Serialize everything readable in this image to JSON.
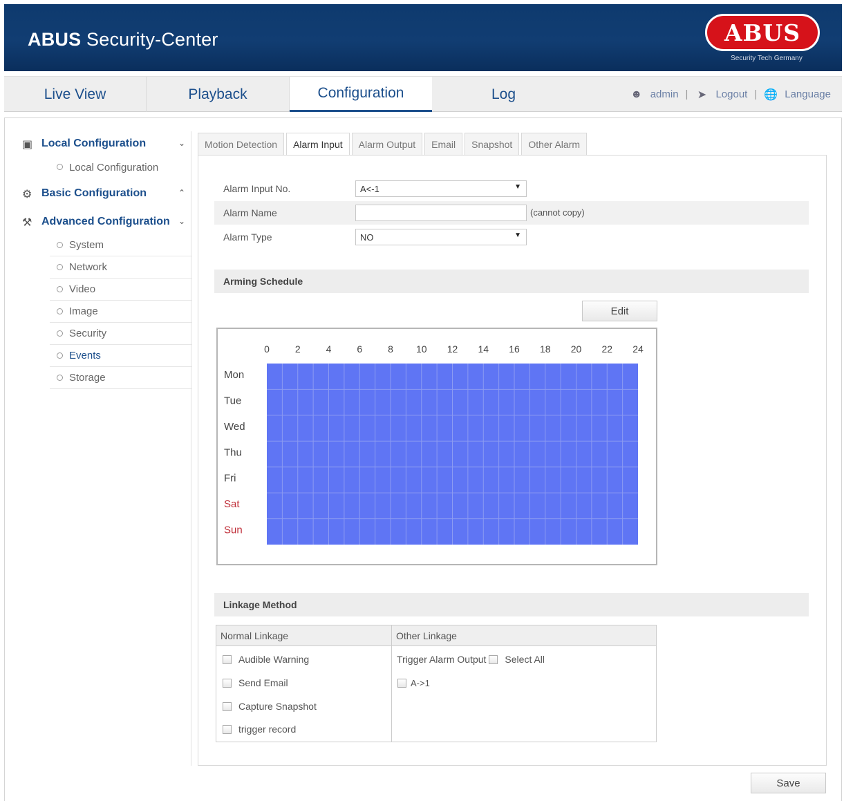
{
  "header": {
    "title_brand": "ABUS",
    "title_rest": " Security-Center",
    "logo_text": "ABUS",
    "logo_tagline": "Security Tech Germany",
    "colors": {
      "header_bg": "#113d72",
      "logo_red": "#d6121a",
      "link_blue": "#1c4f8c",
      "schedule_fill": "#5f75f4",
      "weekend_red": "#c0303a"
    }
  },
  "nav": {
    "tabs": [
      "Live View",
      "Playback",
      "Configuration",
      "Log"
    ],
    "active_tab": "Configuration",
    "user": "admin",
    "logout": "Logout",
    "language": "Language",
    "sep": "|"
  },
  "sidebar": {
    "local_group": "Local Configuration",
    "local_items": [
      "Local Configuration"
    ],
    "basic_group": "Basic Configuration",
    "advanced_group": "Advanced Configuration",
    "advanced_items": [
      "System",
      "Network",
      "Video",
      "Image",
      "Security",
      "Events",
      "Storage"
    ]
  },
  "subtabs": [
    "Motion Detection",
    "Alarm Input",
    "Alarm Output",
    "Email",
    "Snapshot",
    "Other Alarm"
  ],
  "active_subtab": "Alarm Input",
  "form": {
    "alarm_input_no_label": "Alarm Input No.",
    "alarm_input_no_value": "A<-1",
    "alarm_name_label": "Alarm Name",
    "alarm_name_value": "",
    "alarm_name_hint": "(cannot copy)",
    "alarm_type_label": "Alarm Type",
    "alarm_type_value": "NO"
  },
  "arming": {
    "title": "Arming Schedule",
    "edit_button": "Edit",
    "hours": [
      "0",
      "2",
      "4",
      "6",
      "8",
      "10",
      "12",
      "14",
      "16",
      "18",
      "20",
      "22",
      "24"
    ],
    "days": [
      "Mon",
      "Tue",
      "Wed",
      "Thu",
      "Fri",
      "Sat",
      "Sun"
    ],
    "weekend_days": [
      "Sat",
      "Sun"
    ],
    "armed_start_hour": 0,
    "armed_end_hour": 24
  },
  "linkage": {
    "title": "Linkage Method",
    "normal_header": "Normal Linkage",
    "other_header": "Other Linkage",
    "normal_items": [
      "Audible Warning",
      "Send Email",
      "Capture Snapshot",
      "trigger record"
    ],
    "trigger_label": "Trigger Alarm Output",
    "select_all": "Select All",
    "outputs": [
      "A->1"
    ]
  },
  "save_button": "Save"
}
